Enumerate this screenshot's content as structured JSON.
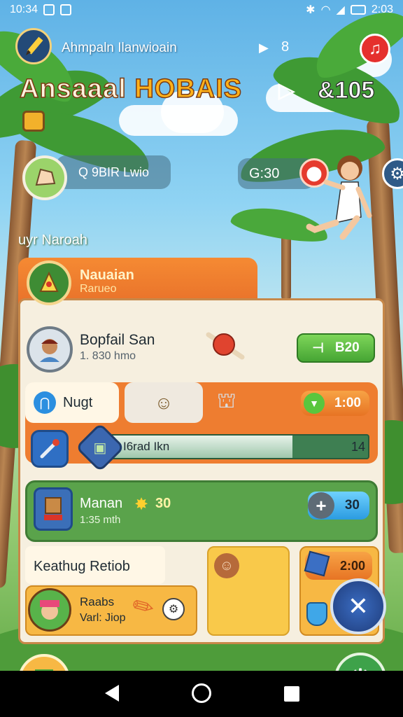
{
  "status_bar": {
    "time": "10:34",
    "right_time": "2:03"
  },
  "header": {
    "subtitle": "Ahmpaln Ilanwioain",
    "title_part1": "Ansaaal",
    "title_part2": "HOBAIS",
    "score": "&105",
    "play_glyph": "▶",
    "ring_glyph": "8",
    "mini_play_glyph": "▷"
  },
  "player_pill": {
    "text": "Q 9BIR Lwio"
  },
  "timer_pill": {
    "text": "G:30"
  },
  "section_label": "uyr Naroah",
  "panel": {
    "title": "Nauaian",
    "subtitle": "Rarueo"
  },
  "profile": {
    "name": "Bopfail San",
    "detail": "1. 830 hmo",
    "button": "B20"
  },
  "tabs": {
    "tab1_label": "Nugt",
    "reward": "1:00"
  },
  "progress": {
    "label": "I6rad Ikn",
    "value": "14"
  },
  "mission": {
    "name": "Manan",
    "detail": "1:35 mth",
    "points": "30",
    "button": "30"
  },
  "event": {
    "title": "Keathug Retiob",
    "name": "Raabs",
    "detail": "Varl: Jiop"
  },
  "shop": {
    "price": "2:00"
  },
  "colors": {
    "accent_orange": "#ee7d30",
    "accent_green": "#5aa34b",
    "card_bg": "#f6efdf",
    "title_gold": "#ffb21a"
  },
  "icons": [
    "pencil-icon",
    "music-icon",
    "settings-icon",
    "tools-icon",
    "gear-icon",
    "back-icon",
    "home-icon",
    "recents-icon"
  ]
}
